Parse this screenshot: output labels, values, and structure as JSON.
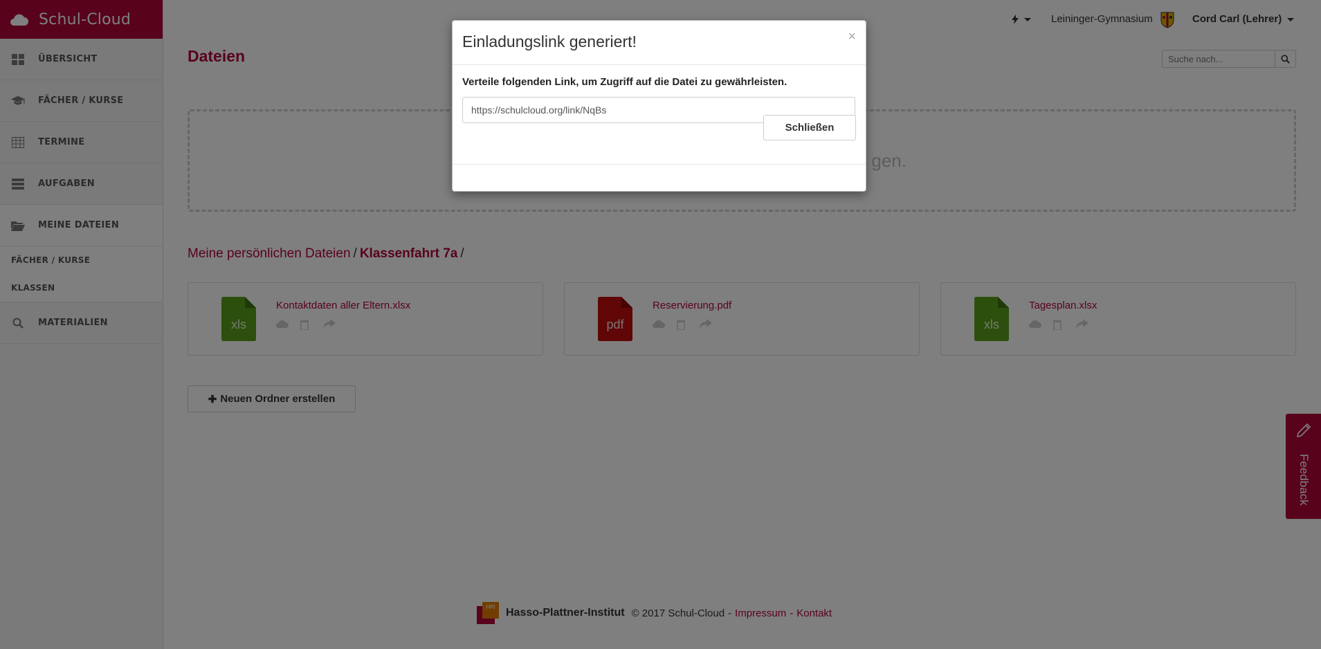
{
  "app": {
    "brand": "Schul-Cloud"
  },
  "sidebar": {
    "items": [
      {
        "label": "ÜBERSICHT",
        "icon": "dashboard-icon"
      },
      {
        "label": "FÄCHER / KURSE",
        "icon": "graduation-cap-icon"
      },
      {
        "label": "TERMINE",
        "icon": "calendar-table-icon"
      },
      {
        "label": "AUFGABEN",
        "icon": "tasks-icon"
      },
      {
        "label": "MEINE DATEIEN",
        "icon": "folder-open-icon"
      }
    ],
    "subitems": [
      {
        "label": "FÄCHER / KURSE"
      },
      {
        "label": "KLASSEN"
      }
    ],
    "last_item": {
      "label": "MATERIALIEN",
      "icon": "search-icon"
    }
  },
  "topbar": {
    "school": "Leininger-Gymnasium",
    "user": "Cord Carl (Lehrer)"
  },
  "main": {
    "title": "Dateien",
    "search_placeholder": "Suche nach...",
    "dropzone_text": "gen.",
    "breadcrumb": {
      "root": "Meine persönlichen Dateien",
      "current": "Klassenfahrt 7a",
      "separator": "/"
    },
    "files": [
      {
        "name": "Kontaktdaten aller Eltern.xlsx",
        "ext": "xls",
        "color": "#5b9e1a"
      },
      {
        "name": "Reservierung.pdf",
        "ext": "pdf",
        "color": "#c00d0d"
      },
      {
        "name": "Tagesplan.xlsx",
        "ext": "xls",
        "color": "#5b9e1a"
      }
    ],
    "new_folder_label": "Neuen Ordner erstellen"
  },
  "footer": {
    "hpi_badge": "HPI",
    "org": "Hasso-Plattner-Institut",
    "copyright": "© 2017 Schul-Cloud",
    "dash": "-",
    "impressum": "Impressum",
    "kontakt": "Kontakt"
  },
  "feedback": {
    "label": "Feedback"
  },
  "modal": {
    "title": "Einladungslink generiert!",
    "close_symbol": "×",
    "label": "Verteile folgenden Link, um Zugriff auf die Datei zu gewährleisten.",
    "link": "https://schulcloud.org/link/NqBs",
    "close_button": "Schließen"
  },
  "colors": {
    "brand": "#b10438",
    "xls": "#5b9e1a",
    "pdf": "#c00d0d"
  }
}
